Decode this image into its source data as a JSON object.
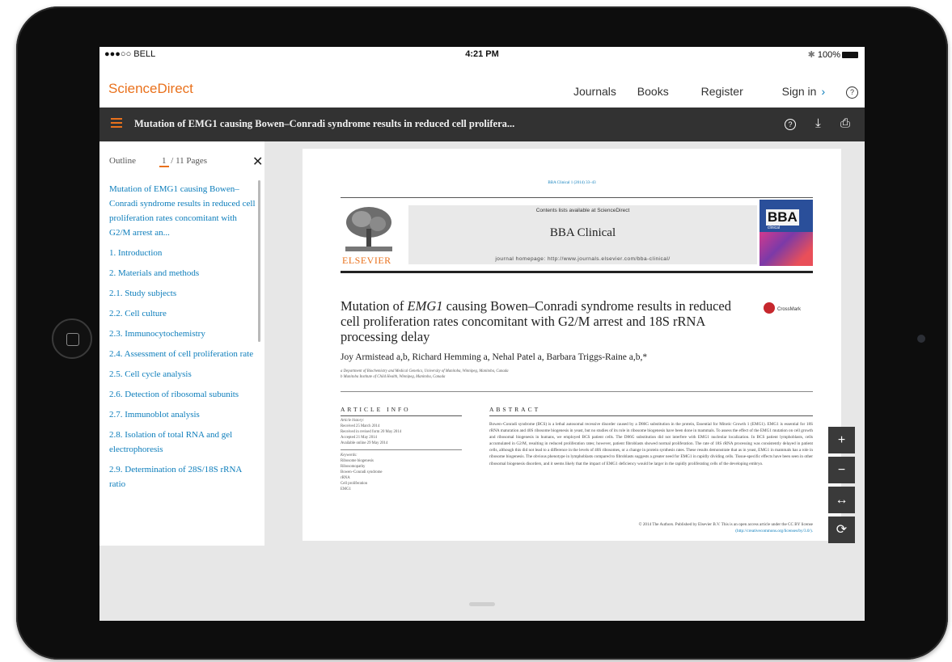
{
  "status_bar": {
    "carrier": "●●●○○ BELL",
    "time": "4:21 PM",
    "battery": "100%"
  },
  "nav": {
    "brand": "ScienceDirect",
    "journals": "Journals",
    "books": "Books",
    "register": "Register",
    "sign_in": "Sign in",
    "sign_in_chevron": "›",
    "help": "?"
  },
  "doc_bar": {
    "title": "Mutation of EMG1 causing Bowen–Conradi syndrome results in reduced cell prolifera...",
    "help": "?",
    "download_icon": "⤓",
    "print_icon": "⎙"
  },
  "outline": {
    "label": "Outline",
    "current_page": "1",
    "separator": "/",
    "total_pages": "11 Pages",
    "close": "✕",
    "items": [
      "Mutation of EMG1 causing Bowen–Conradi syndrome results in reduced cell proliferation rates concomitant with G2/M arrest an...",
      "1. Introduction",
      "2. Materials and methods",
      "2.1. Study subjects",
      "2.2. Cell culture",
      "2.3. Immunocytochemistry",
      "2.4. Assessment of cell proliferation rate",
      "2.5. Cell cycle analysis",
      "2.6. Detection of ribosomal subunits",
      "2.7. Immunoblot analysis",
      "2.8. Isolation of total RNA and gel electrophoresis",
      "2.9. Determination of 28S/18S rRNA ratio"
    ]
  },
  "zoom_controls": {
    "zoom_in": "+",
    "zoom_out": "−",
    "fit_width": "↔",
    "rotate": "⟳"
  },
  "pdf": {
    "journal_ref": "BBA Clinical 1 (2014) 33–43",
    "contents_lists": "Contents lists available at ScienceDirect",
    "journal_name": "BBA Clinical",
    "homepage": "journal homepage: http://www.journals.elsevier.com/bba-clinical/",
    "publisher": "ELSEVIER",
    "cover_title": "BBA",
    "cover_subtitle": "clinical",
    "crossmark": "CrossMark",
    "article_title_pre": "Mutation of ",
    "article_title_gene": "EMG1",
    "article_title_post": " causing Bowen–Conradi syndrome results in reduced cell proliferation rates concomitant with G2/M arrest and 18S rRNA processing delay",
    "authors": "Joy Armistead a,b, Richard Hemming a, Nehal Patel a, Barbara Triggs-Raine a,b,*",
    "affiliation_a": "a Department of Biochemistry and Medical Genetics, University of Manitoba, Winnipeg, Manitoba, Canada",
    "affiliation_b": "b Manitoba Institute of Child Health, Winnipeg, Manitoba, Canada",
    "article_info_head": "ARTICLE INFO",
    "abstract_head": "ABSTRACT",
    "history_label": "Article history:",
    "received": "Received 25 March 2014",
    "revised": "Received in revised form 20 May 2014",
    "accepted": "Accepted 21 May 2014",
    "online": "Available online 29 May 2014",
    "keywords_label": "Keywords:",
    "keywords": [
      "Ribosome biogenesis",
      "Ribosomopathy",
      "Bowen–Conradi syndrome",
      "rRNA",
      "Cell proliferation",
      "EMG1"
    ],
    "abstract": "Bowen–Conradi syndrome (BCS) is a lethal autosomal recessive disorder caused by a D86G substitution in the protein, Essential for Mitotic Growth 1 (EMG1). EMG1 is essential for 18S rRNA maturation and 40S ribosome biogenesis in yeast, but no studies of its role in ribosome biogenesis have been done in mammals. To assess the effect of the EMG1 mutation on cell growth and ribosomal biogenesis in humans, we employed BCS patient cells. The D86G substitution did not interfere with EMG1 nucleolar localization. In BCS patient lymphoblasts, cells accumulated in G2/M, resulting in reduced proliferation rates; however, patient fibroblasts showed normal proliferation. The rate of 18S rRNA processing was consistently delayed in patient cells, although this did not lead to a difference in the levels of 40S ribosomes, or a change in protein synthesis rates. These results demonstrate that as in yeast, EMG1 in mammals has a role in ribosome biogenesis. The obvious phenotype in lymphoblasts compared to fibroblasts suggests a greater need for EMG1 in rapidly dividing cells. Tissue-specific effects have been seen in other ribosomal biogenesis disorders, and it seems likely that the impact of EMG1 deficiency would be larger in the rapidly proliferating cells of the developing embryo.",
    "license": "© 2014 The Authors. Published by Elsevier B.V. This is an open access article under the CC BY license",
    "license_url": "(http://creativecommons.org/licenses/by/3.0/)."
  },
  "colors": {
    "brand_orange": "#e9711c",
    "link_blue": "#0c7dbb",
    "doc_bar": "#323232"
  }
}
